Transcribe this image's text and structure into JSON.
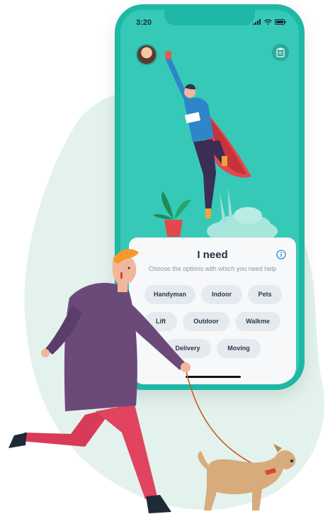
{
  "colors": {
    "phone_frame": "#1fb7a5",
    "screen_bg": "#36c9b8",
    "card_bg": "#f6f8fa",
    "chip_bg": "#e5eaef",
    "title_text": "#253241",
    "accent_info": "#2b8de0"
  },
  "status_bar": {
    "time": "3:20",
    "icons": [
      "signal-icon",
      "wifi-icon",
      "battery-icon"
    ]
  },
  "header": {
    "avatar_icon": "user-avatar",
    "clipboard_icon": "clipboard-icon"
  },
  "card": {
    "title": "I need",
    "subtitle": "Choose the options with which you need help",
    "info_icon": "info-icon",
    "options": [
      "Handyman",
      "Indoor",
      "Pets",
      "Lift",
      "Outdoor",
      "Walkme",
      "Delivery",
      "Moving"
    ]
  }
}
